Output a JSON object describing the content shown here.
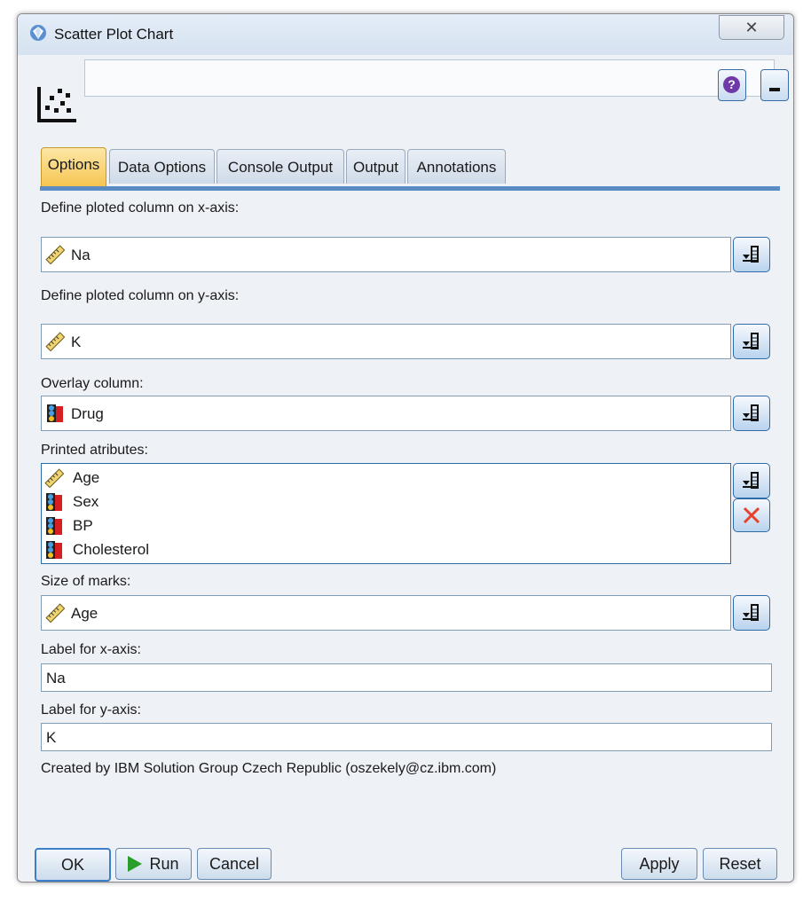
{
  "window": {
    "title": "Scatter Plot Chart",
    "close_glyph": "✕"
  },
  "header": {
    "node_name": "",
    "help_glyph": "?"
  },
  "tabs": [
    {
      "label": "Options",
      "active": true
    },
    {
      "label": "Data Options",
      "active": false
    },
    {
      "label": "Console Output",
      "active": false
    },
    {
      "label": "Output",
      "active": false
    },
    {
      "label": "Annotations",
      "active": false
    }
  ],
  "form": {
    "x_axis": {
      "label": "Define ploted column on x-axis:",
      "value": "Na",
      "icon": "continuous-ruler-icon"
    },
    "y_axis": {
      "label": "Define ploted column on y-axis:",
      "value": "K",
      "icon": "continuous-ruler-icon"
    },
    "overlay": {
      "label": "Overlay column:",
      "value": "Drug",
      "icon": "nominal-set-icon"
    },
    "printed": {
      "label": "Printed atributes:",
      "items": [
        {
          "value": "Age",
          "icon": "continuous-ruler-icon"
        },
        {
          "value": "Sex",
          "icon": "nominal-set-icon"
        },
        {
          "value": "BP",
          "icon": "nominal-set-icon"
        },
        {
          "value": "Cholesterol",
          "icon": "nominal-set-icon"
        }
      ]
    },
    "size": {
      "label": "Size of marks:",
      "value": "Age",
      "icon": "continuous-ruler-icon"
    },
    "x_label": {
      "label": "Label for x-axis:",
      "value": "Na"
    },
    "y_label": {
      "label": "Label for y-axis:",
      "value": "K"
    },
    "note": "Created by IBM Solution Group Czech Republic (oszekely@cz.ibm.com)"
  },
  "buttons": {
    "ok": "OK",
    "run": "Run",
    "cancel": "Cancel",
    "apply": "Apply",
    "reset": "Reset"
  },
  "colors": {
    "tab_active": "#f5c44f",
    "accent": "#5b8bc3",
    "delete": "#e8412a",
    "run": "#2a9d2a"
  }
}
